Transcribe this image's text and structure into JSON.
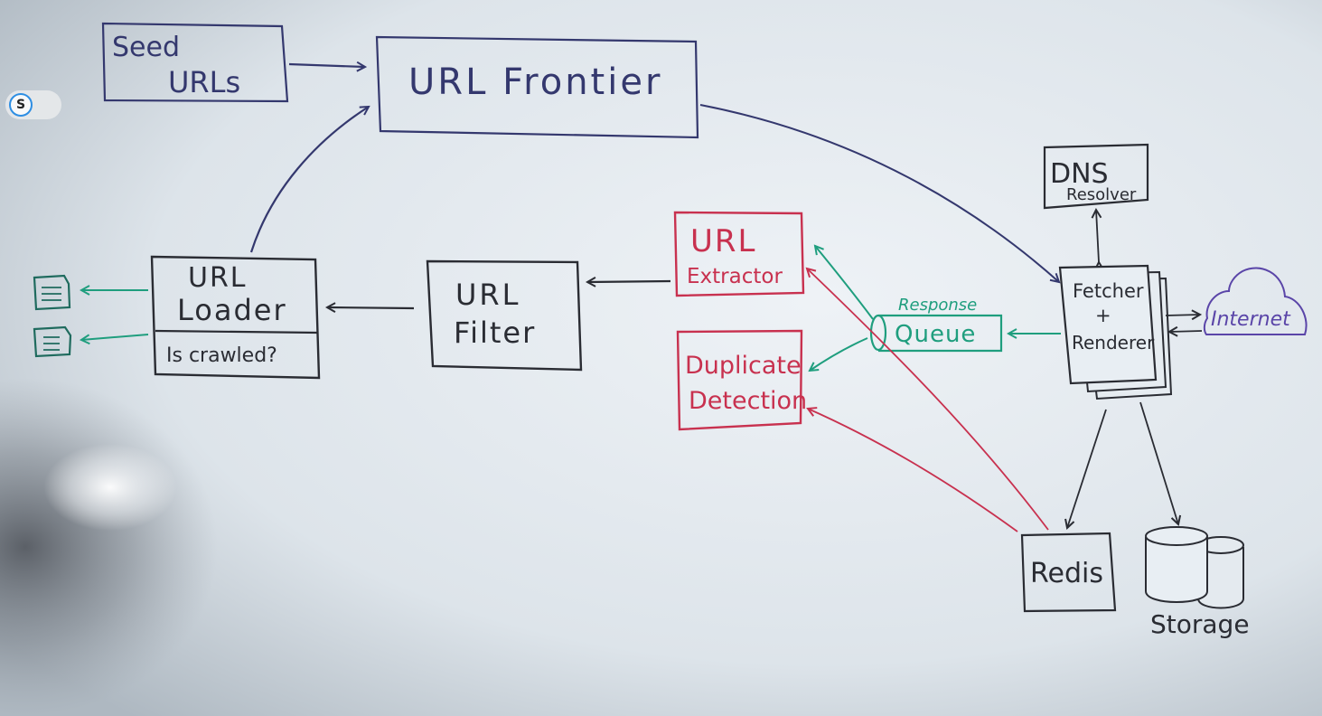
{
  "colors": {
    "board_center": "#e8eef4",
    "board_edge": "#b9c3cc",
    "ink_navy": "#34386e",
    "ink_dark": "#2a2c33",
    "ink_red": "#c8314f",
    "ink_green": "#1f9e7e",
    "ink_purple": "#5a45a8",
    "chip_accent": "#1e88e5"
  },
  "overlay": {
    "chip_label": "S",
    "chip_icon": "s-logo-icon"
  },
  "nodes": {
    "seed": {
      "line1": "Seed",
      "line2": "URLs"
    },
    "frontier": {
      "label": "URL Frontier"
    },
    "loader": {
      "line1": "URL",
      "line2": "Loader",
      "footer": "Is crawled?"
    },
    "filter": {
      "line1": "URL",
      "line2": "Filter"
    },
    "extractor": {
      "line1": "URL",
      "line2": "Extractor"
    },
    "duplicate": {
      "line1": "Duplicate",
      "line2": "Detection"
    },
    "queue": {
      "title": "Response",
      "label": "Queue"
    },
    "fetcher": {
      "line1": "Fetcher",
      "line2": "+",
      "line3": "Renderer"
    },
    "dns": {
      "line1": "DNS",
      "line2": "Resolver"
    },
    "internet": {
      "label": "Internet"
    },
    "redis": {
      "label": "Redis"
    },
    "storage": {
      "label": "Storage"
    }
  },
  "icons": {
    "doc": "document-icon",
    "cloud": "cloud-icon",
    "db": "database-icon"
  }
}
